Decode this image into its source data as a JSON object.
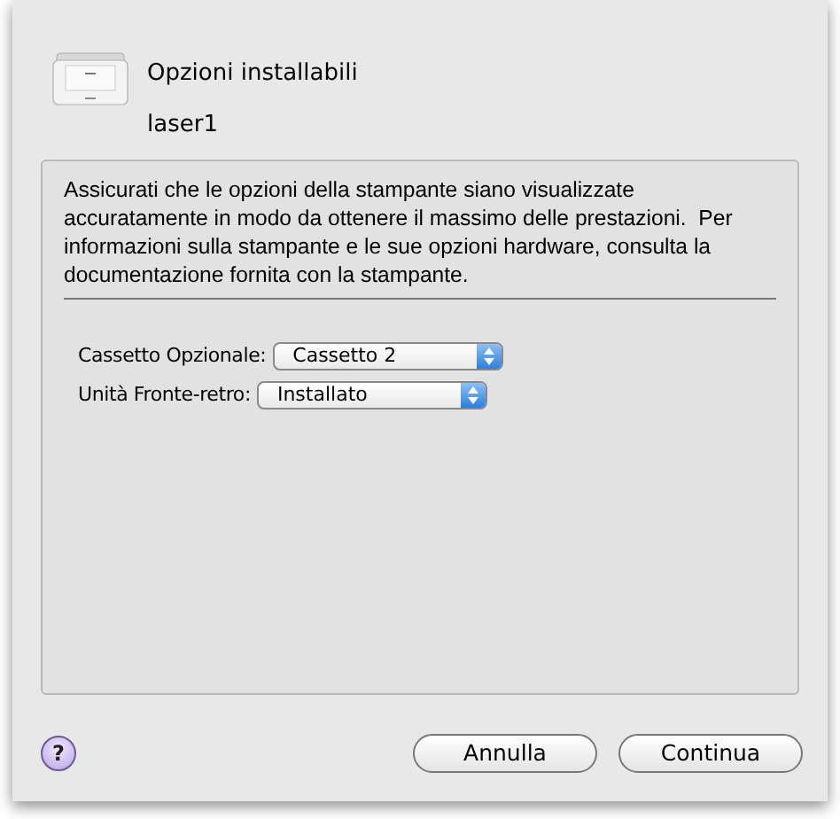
{
  "header": {
    "title": "Opzioni installabili",
    "subtitle": "laser1"
  },
  "description": "Assicurati che le opzioni della stampante siano visualizzate accuratamente in modo da ottenere il massimo delle prestazioni.  Per informazioni sulla stampante e le sue opzioni hardware, consulta la documentazione fornita con la stampante.",
  "options": [
    {
      "label": "Cassetto Opzionale:",
      "value": "Cassetto 2"
    },
    {
      "label": "Unità Fronte-retro:",
      "value": "Installato"
    }
  ],
  "help": "?",
  "buttons": [
    {
      "label": "Annulla",
      "default": false
    },
    {
      "label": "Continua",
      "default": false
    }
  ]
}
